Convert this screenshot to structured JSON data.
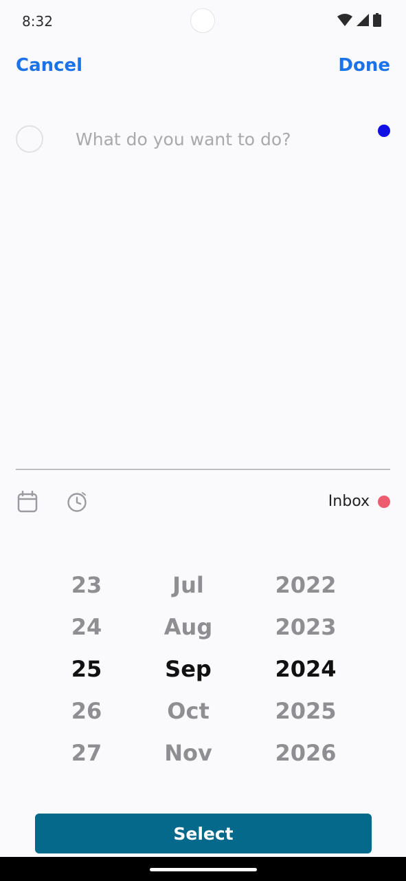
{
  "status_bar": {
    "time": "8:32",
    "icons": [
      "wifi-icon",
      "signal-icon",
      "battery-icon"
    ]
  },
  "header": {
    "cancel_label": "Cancel",
    "done_label": "Done"
  },
  "task": {
    "placeholder": "What do you want to do?",
    "value": "",
    "priority_color": "#1010e6"
  },
  "toolbar": {
    "icons": [
      "calendar-icon",
      "clock-icon"
    ],
    "project_label": "Inbox",
    "project_color": "#ec5b6e"
  },
  "date_picker": {
    "days": [
      "23",
      "24",
      "25",
      "26",
      "27"
    ],
    "months": [
      "Jul",
      "Aug",
      "Sep",
      "Oct",
      "Nov"
    ],
    "years": [
      "2022",
      "2023",
      "2024",
      "2025",
      "2026"
    ],
    "selected": {
      "day": "25",
      "month": "Sep",
      "year": "2024"
    }
  },
  "select_button": {
    "label": "Select",
    "color": "#05698b"
  },
  "colors": {
    "accent": "#1a73e8",
    "background": "#fafafc"
  }
}
